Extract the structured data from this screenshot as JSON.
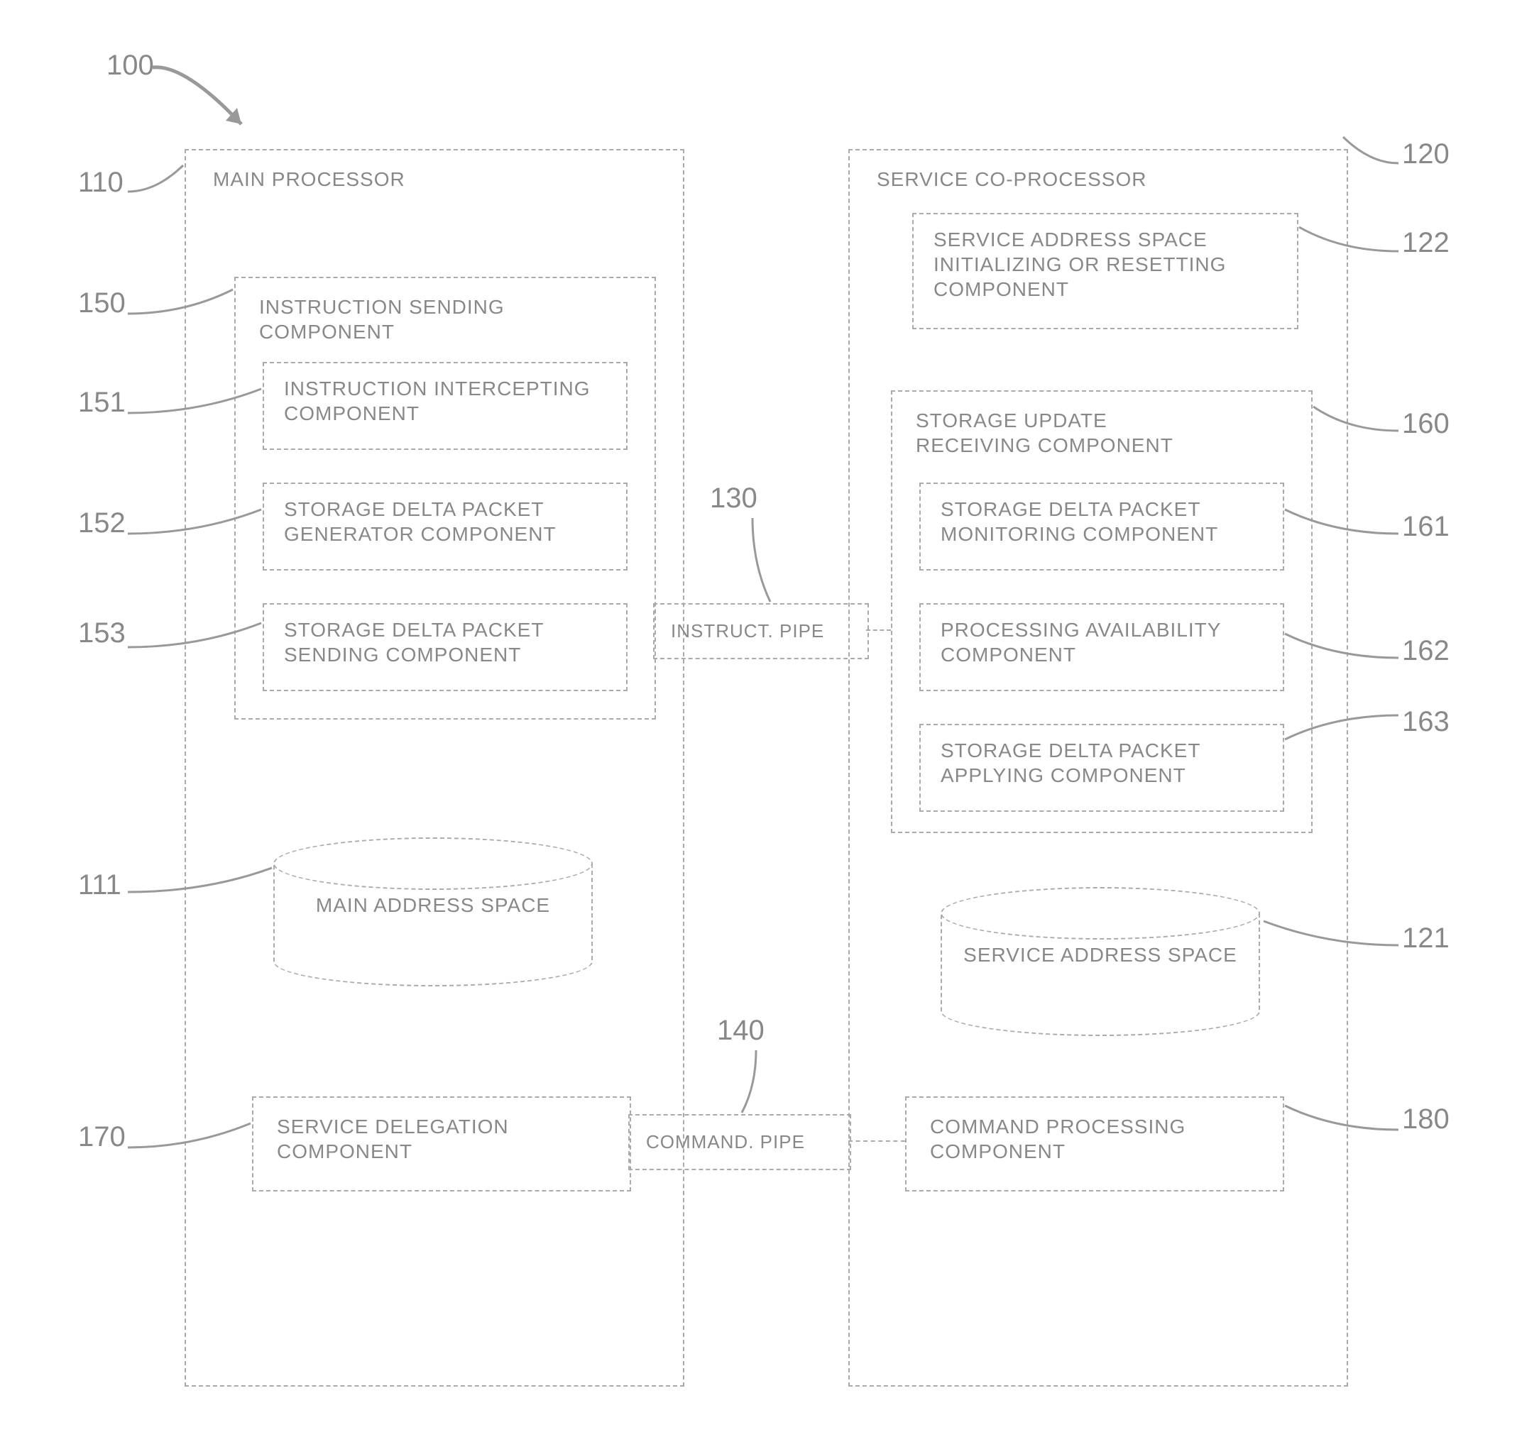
{
  "ref": {
    "r100": "100",
    "r110": "110",
    "r120": "120",
    "r150": "150",
    "r151": "151",
    "r152": "152",
    "r153": "153",
    "r111": "111",
    "r170": "170",
    "r130": "130",
    "r140": "140",
    "r122": "122",
    "r160": "160",
    "r161": "161",
    "r162": "162",
    "r163": "163",
    "r121": "121",
    "r180": "180"
  },
  "main": {
    "title": "MAIN PROCESSOR",
    "instr_send": {
      "title": "INSTRUCTION SENDING COMPONENT",
      "c1": "INSTRUCTION INTERCEPTING COMPONENT",
      "c2": "STORAGE DELTA PACKET GENERATOR COMPONENT",
      "c3": "STORAGE DELTA PACKET SENDING COMPONENT"
    },
    "addr_space": "MAIN ADDRESS SPACE",
    "svc_deleg": "SERVICE DELEGATION COMPONENT"
  },
  "co": {
    "title": "SERVICE CO-PROCESSOR",
    "init": "SERVICE ADDRESS SPACE INITIALIZING OR RESETTING COMPONENT",
    "recv": {
      "title": "STORAGE UPDATE RECEIVING COMPONENT",
      "c1": "STORAGE DELTA PACKET MONITORING COMPONENT",
      "c2": "PROCESSING AVAILABILITY COMPONENT",
      "c3": "STORAGE DELTA PACKET APPLYING COMPONENT"
    },
    "addr_space": "SERVICE ADDRESS SPACE",
    "cmd_proc": "COMMAND PROCESSING COMPONENT"
  },
  "pipes": {
    "instruct": "INSTRUCT. PIPE",
    "command": "COMMAND. PIPE"
  }
}
